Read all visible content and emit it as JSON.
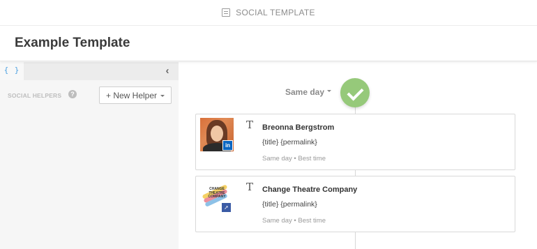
{
  "header": {
    "title": "SOCIAL TEMPLATE",
    "icon": "template-icon"
  },
  "page": {
    "title": "Example Template"
  },
  "sidebar": {
    "code_toggle": "{ }",
    "collapse_icon": "chevron-left-icon",
    "helpers_label": "SOCIAL HELPERS",
    "help_icon": "?",
    "new_helper_label": "+ New Helper"
  },
  "timeline": {
    "schedule_label": "Same day",
    "status_icon": "check-icon",
    "status_color": "#96c97a"
  },
  "posts": [
    {
      "name": "Breonna Bergstrom",
      "body": "{title} {permalink}",
      "meta": "Same day • Best time",
      "network": "LinkedIn",
      "badge": "in",
      "badge_color": "#0a66c2"
    },
    {
      "name": "Change Theatre Company",
      "body": "{title} {permalink}",
      "meta": "Same day • Best time",
      "network": "Facebook",
      "logo_text": "CHANGE THEATRE COMPANY",
      "badge_color": "#3b5ba5"
    }
  ]
}
